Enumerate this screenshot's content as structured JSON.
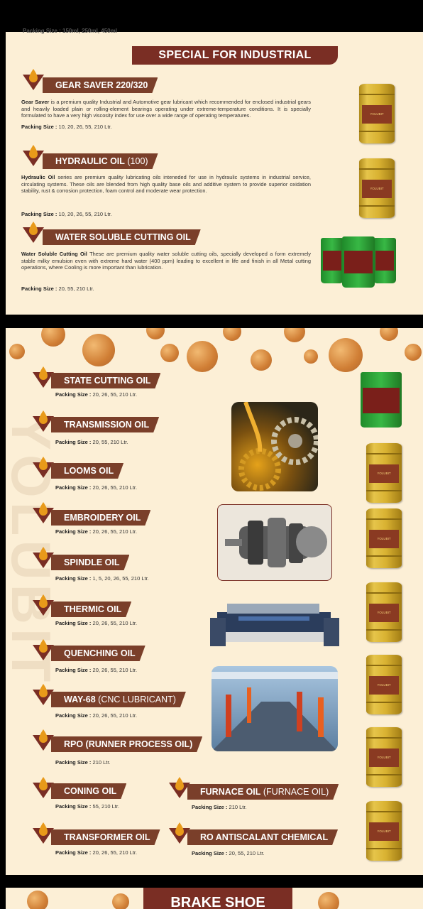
{
  "top_cut_text": "Packing Size : 150ml, 250ml, 450ml",
  "section_title": "SPECIAL FOR INDUSTRIAL",
  "industrial": [
    {
      "name": "GEAR SAVER 220/320",
      "name_light": "",
      "desc_lead": "Gear Saver",
      "desc": " is a premium quality Industrial and Automotive gear lubricant which recommended for enclosed industrial gears and heavily loaded plain or rolling-element bearings operating under extreme-temperature conditions. It is specially formulated to have a very high viscosity index for use over a wide range of operating temperatures.",
      "pack_label": "Packing Size : ",
      "pack": "10, 20, 26, 55, 210 Ltr."
    },
    {
      "name": "HYDRAULIC OIL",
      "name_light": " (100)",
      "desc_lead": "Hydraulic Oil",
      "desc": " series are premium quality lubricating oils inteneded for use in hydraulic systems in industrial service, circulating systems. These oils are blended from high quality base oils and additive system to provide superior oxidation stability, rust & corrosion protection, foam control and moderate wear protection.",
      "pack_label": "Packing Size : ",
      "pack": "10, 20, 26, 55, 210 Ltr."
    },
    {
      "name": "WATER SOLUBLE CUTTING OIL",
      "name_light": "",
      "desc_lead": "Water Soluble Cutting Oil",
      "desc": " These are premium quality water soluble cutting oils, specially developed a form extremely stable milky emulsion even with extreme hard water (400 ppm) leading to excellent in life and finish in all Metal cutting operations, where Cooling is more important than lubrication.",
      "pack_label": "Packing Size : ",
      "pack": "20, 55, 210 Ltr."
    }
  ],
  "drum_label": "YOLUBIT",
  "products": [
    {
      "name": "STATE CUTTING OIL",
      "name_light": "",
      "pack_label": "Packing Size : ",
      "pack": "20, 26, 55, 210 Ltr."
    },
    {
      "name": "TRANSMISSION OIL",
      "name_light": "",
      "pack_label": "Packing Size : ",
      "pack": "20, 55, 210 Ltr."
    },
    {
      "name": "LOOMS OIL",
      "name_light": "",
      "pack_label": "Packing Size : ",
      "pack": "20, 26, 55, 210 Ltr."
    },
    {
      "name": "EMBROIDERY OIL",
      "name_light": "",
      "pack_label": "Packing Size : ",
      "pack": "20, 26, 55, 210 Ltr."
    },
    {
      "name": "SPINDLE OIL",
      "name_light": "",
      "pack_label": "Packing Size : ",
      "pack": "1, 5, 20, 26, 55, 210 Ltr."
    },
    {
      "name": "THERMIC OIL",
      "name_light": "",
      "pack_label": "Packing Size : ",
      "pack": "20, 26, 55, 210 Ltr."
    },
    {
      "name": "QUENCHING OIL",
      "name_light": "",
      "pack_label": "Packing Size : ",
      "pack": "20, 26, 55, 210 Ltr."
    },
    {
      "name": "WAY-68",
      "name_light": " (CNC LUBRICANT)",
      "pack_label": "Packing Size : ",
      "pack": "20, 26, 55, 210 Ltr."
    },
    {
      "name": "RPO  (RUNNER PROCESS OIL)",
      "name_light": "",
      "pack_label": "Packing Size : ",
      "pack": "210 Ltr."
    },
    {
      "name": "CONING OIL",
      "name_light": "",
      "pack_label": "Packing Size : ",
      "pack": "55, 210 Ltr."
    },
    {
      "name": "TRANSFORMER OIL",
      "name_light": "",
      "pack_label": "Packing Size : ",
      "pack": "20, 26, 55, 210 Ltr."
    }
  ],
  "products_right": [
    {
      "name": "FURNACE OIL",
      "name_light": " (FURNACE OIL)",
      "pack_label": "Packing Size : ",
      "pack": "210 Ltr."
    },
    {
      "name": "RO ANTISCALANT CHEMICAL",
      "name_light": "",
      "pack_label": "Packing Size : ",
      "pack": "20, 55, 210 Ltr."
    }
  ],
  "watermark": "YOLUBIT",
  "next_section_title": "BRAKE SHOE",
  "colors": {
    "banner": "#7a2e24",
    "pill": "#7a3f2a",
    "background": "#fcefd6",
    "drum": "#d9b232",
    "bucket": "#2ea83a"
  }
}
